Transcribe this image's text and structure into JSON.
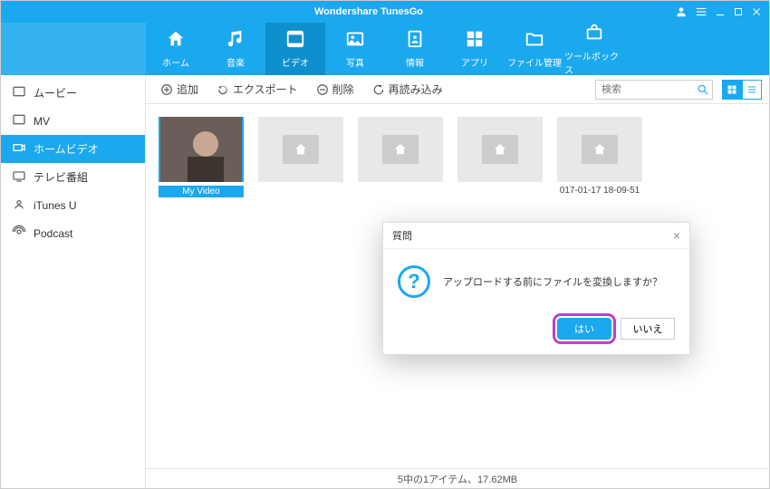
{
  "window": {
    "title": "Wondershare TunesGo"
  },
  "nav": {
    "items": [
      {
        "label": "ホーム",
        "icon": "home"
      },
      {
        "label": "音楽",
        "icon": "music"
      },
      {
        "label": "ビデオ",
        "icon": "video",
        "active": true
      },
      {
        "label": "写真",
        "icon": "photo"
      },
      {
        "label": "情報",
        "icon": "contacts"
      },
      {
        "label": "アプリ",
        "icon": "apps"
      },
      {
        "label": "ファイル管理",
        "icon": "folder"
      },
      {
        "label": "ツールボックス",
        "icon": "toolbox"
      }
    ]
  },
  "sidebar": {
    "items": [
      {
        "label": "ムービー",
        "icon": "movie"
      },
      {
        "label": "MV",
        "icon": "mv"
      },
      {
        "label": "ホームビデオ",
        "icon": "homevideo",
        "active": true
      },
      {
        "label": "テレビ番組",
        "icon": "tv"
      },
      {
        "label": "iTunes U",
        "icon": "itunesu"
      },
      {
        "label": "Podcast",
        "icon": "podcast"
      }
    ]
  },
  "toolbar": {
    "add": "追加",
    "export": "エクスポート",
    "delete": "削除",
    "reload": "再読み込み",
    "search_placeholder": "検索"
  },
  "grid": {
    "items": [
      {
        "caption": "My Video",
        "selected": true,
        "hasImage": true
      },
      {
        "caption": "",
        "selected": false,
        "hasImage": false
      },
      {
        "caption": "",
        "selected": false,
        "hasImage": false
      },
      {
        "caption": "",
        "selected": false,
        "hasImage": false
      },
      {
        "caption": "017-01-17 18-09-51",
        "selected": false,
        "hasImage": false
      }
    ]
  },
  "statusbar": {
    "text": "5中の1アイテム、17.62MB"
  },
  "dialog": {
    "title": "質問",
    "message": "アップロードする前にファイルを変換しますか？",
    "yes": "はい",
    "no": "いいえ"
  }
}
